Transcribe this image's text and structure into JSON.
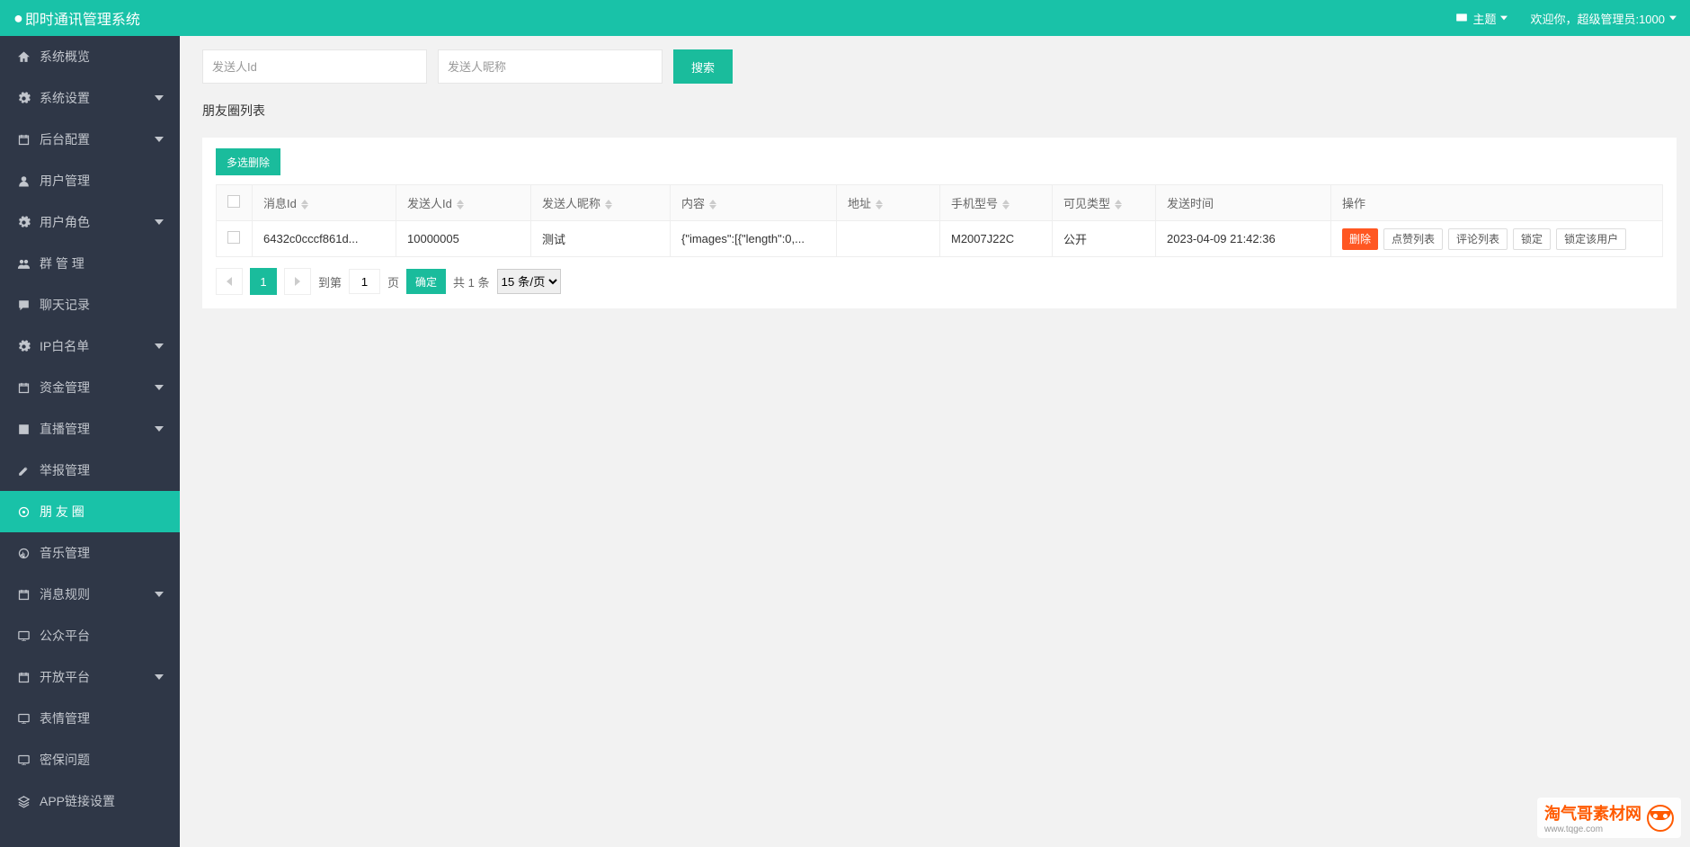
{
  "header": {
    "title": "即时通讯管理系统",
    "theme_label": "主题",
    "welcome": "欢迎你，超级管理员:1000"
  },
  "sidebar": {
    "items": [
      {
        "label": "系统概览",
        "icon": "home",
        "has_sub": false
      },
      {
        "label": "系统设置",
        "icon": "gear",
        "has_sub": true
      },
      {
        "label": "后台配置",
        "icon": "calendar",
        "has_sub": true
      },
      {
        "label": "用户管理",
        "icon": "user",
        "has_sub": false
      },
      {
        "label": "用户角色",
        "icon": "gear",
        "has_sub": true
      },
      {
        "label": "群 管 理",
        "icon": "group",
        "has_sub": false
      },
      {
        "label": "聊天记录",
        "icon": "chat",
        "has_sub": false
      },
      {
        "label": "IP白名单",
        "icon": "gear",
        "has_sub": true
      },
      {
        "label": "资金管理",
        "icon": "calendar",
        "has_sub": true
      },
      {
        "label": "直播管理",
        "icon": "play",
        "has_sub": true
      },
      {
        "label": "举报管理",
        "icon": "edit",
        "has_sub": false
      },
      {
        "label": "朋 友 圈",
        "icon": "circle",
        "has_sub": false,
        "active": true
      },
      {
        "label": "音乐管理",
        "icon": "music",
        "has_sub": false
      },
      {
        "label": "消息规则",
        "icon": "calendar",
        "has_sub": true
      },
      {
        "label": "公众平台",
        "icon": "monitor",
        "has_sub": false
      },
      {
        "label": "开放平台",
        "icon": "calendar",
        "has_sub": true
      },
      {
        "label": "表情管理",
        "icon": "monitor",
        "has_sub": false
      },
      {
        "label": "密保问题",
        "icon": "monitor",
        "has_sub": false
      },
      {
        "label": "APP链接设置",
        "icon": "layers",
        "has_sub": false
      }
    ]
  },
  "search": {
    "sender_id_placeholder": "发送人Id",
    "sender_name_placeholder": "发送人昵称",
    "btn": "搜索"
  },
  "section_title": "朋友圈列表",
  "multi_delete": "多选删除",
  "table": {
    "columns": [
      "消息Id",
      "发送人Id",
      "发送人昵称",
      "内容",
      "地址",
      "手机型号",
      "可见类型",
      "发送时间",
      "操作"
    ],
    "rows": [
      {
        "msg_id": "6432c0cccf861d...",
        "sender_id": "10000005",
        "sender_name": "测试",
        "content": "{\"images\":[{\"length\":0,...",
        "address": "",
        "phone_model": "M2007J22C",
        "visible_type": "公开",
        "send_time": "2023-04-09 21:42:36"
      }
    ],
    "actions": {
      "delete": "删除",
      "like_list": "点赞列表",
      "comment_list": "评论列表",
      "lock": "锁定",
      "lock_user": "锁定该用户"
    }
  },
  "pager": {
    "current": "1",
    "goto": "到第",
    "page_input": "1",
    "page_suffix": "页",
    "confirm": "确定",
    "total": "共 1 条",
    "per_page": "15 条/页"
  },
  "watermark": {
    "text1": "淘气哥素材网",
    "text2": "www.tqge.com"
  }
}
